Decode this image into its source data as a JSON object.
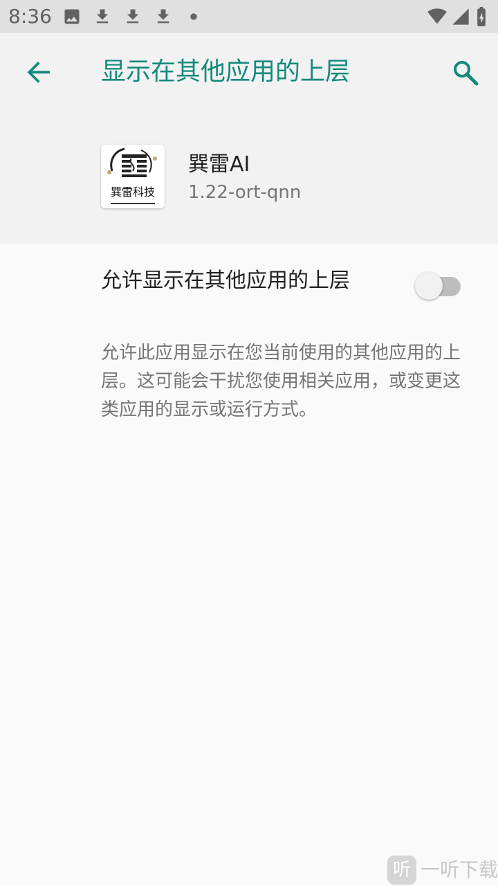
{
  "status_bar": {
    "time": "8:36",
    "icons_left": [
      "image-icon",
      "download-icon",
      "download-icon",
      "download-icon",
      "dot-icon"
    ],
    "icons_right": [
      "wifi-icon",
      "signal-icon",
      "battery-charging-icon"
    ]
  },
  "toolbar": {
    "title": "显示在其他应用的上层",
    "back_icon": "arrow-back-icon",
    "search_icon": "search-icon",
    "accent_color": "#128a7d"
  },
  "app": {
    "name": "巽雷AI",
    "version": "1.22-ort-qnn",
    "icon_text": "巽雷科技"
  },
  "permission": {
    "label": "允许显示在其他应用的上层",
    "enabled": false
  },
  "description": "允许此应用显示在您当前使用的其他应用的上层。这可能会干扰您使用相关应用，或变更这类应用的显示或运行方式。",
  "watermark": {
    "logo_char": "听",
    "text": "一听下载"
  }
}
